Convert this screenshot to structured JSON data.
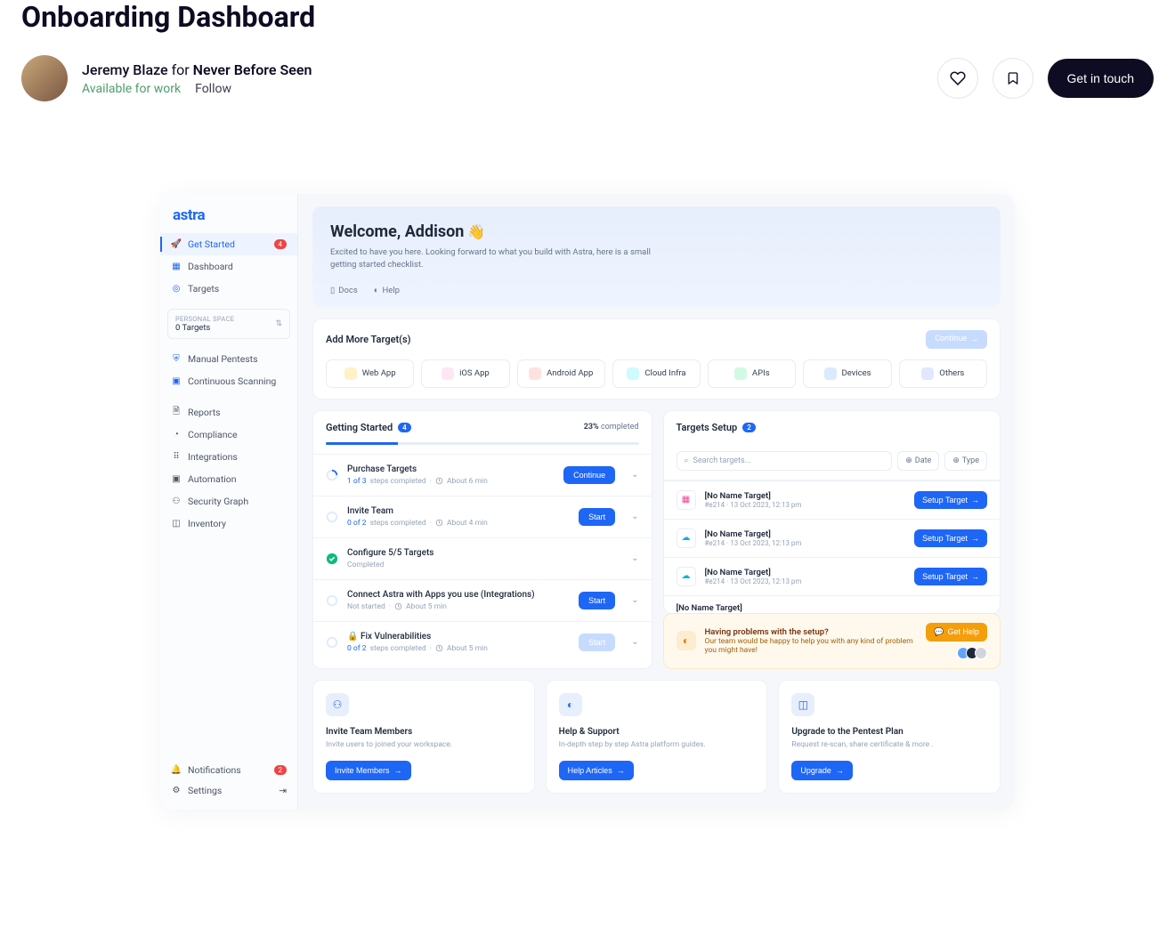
{
  "page": {
    "title": "Onboarding Dashboard",
    "author_name": "Jeremy Blaze",
    "author_for": "for",
    "author_team": "Never Before Seen",
    "available": "Available for work",
    "follow": "Follow",
    "get_in_touch": "Get in touch"
  },
  "sidebar": {
    "brand": "astra",
    "nav": [
      {
        "label": "Get Started",
        "badge": "4"
      },
      {
        "label": "Dashboard"
      },
      {
        "label": "Targets"
      }
    ],
    "space_label": "PERSONAL SPACE",
    "space_value": "0 Targets",
    "nav2": [
      {
        "label": "Manual Pentests"
      },
      {
        "label": "Continuous Scanning"
      }
    ],
    "nav3": [
      {
        "label": "Reports"
      },
      {
        "label": "Compliance"
      },
      {
        "label": "Integrations"
      },
      {
        "label": "Automation"
      },
      {
        "label": "Security Graph"
      },
      {
        "label": "Inventory"
      }
    ],
    "footer": [
      {
        "label": "Notifications",
        "badge": "2"
      },
      {
        "label": "Settings"
      }
    ]
  },
  "welcome": {
    "title": "Welcome, Addison",
    "sub": "Excited to have you here. Looking forward to what you build with Astra, here is a small getting started checklist.",
    "links": [
      "Docs",
      "Help"
    ]
  },
  "add_targets": {
    "title": "Add More Target(s)",
    "continue": "Continue",
    "chips": [
      "Web App",
      "iOS App",
      "Android App",
      "Cloud Infra",
      "APIs",
      "Devices",
      "Others"
    ]
  },
  "getting_started": {
    "title": "Getting Started",
    "count": "4",
    "pct": "23%",
    "completed_label": "completed",
    "rows": [
      {
        "title": "Purchase Targets",
        "sub_pre": "1 of 3",
        "sub_post": "steps completed",
        "time": "About 6 min",
        "btn": "Continue",
        "status": "progress"
      },
      {
        "title": "Invite Team",
        "sub_pre": "0 of 2",
        "sub_post": "steps completed",
        "time": "About 4 min",
        "btn": "Start",
        "status": "progress"
      },
      {
        "title": "Configure 5/5 Targets",
        "sub_complete": "Completed",
        "status": "done"
      },
      {
        "title": "Connect Astra with Apps you use (Integrations)",
        "sub_not": "Not started",
        "time": "About 5 min",
        "btn": "Start",
        "status": "pending"
      },
      {
        "title": "Fix Vulnerabilities",
        "sub_pre": "0 of 2",
        "sub_post": "steps completed",
        "time": "About 5 min",
        "btn": "Start",
        "status": "pending",
        "disabled": true,
        "lock": true
      }
    ]
  },
  "targets_setup": {
    "title": "Targets Setup",
    "count": "2",
    "search_ph": "Search targets...",
    "filter_date": "Date",
    "filter_type": "Type",
    "rows": [
      {
        "name": "[No Name Target]",
        "meta": "#e214   ·   13 Oct 2023, 12:13 pm",
        "btn": "Setup Target"
      },
      {
        "name": "[No Name Target]",
        "meta": "#e214   ·   13 Oct 2023, 12:13 pm",
        "btn": "Setup Target"
      },
      {
        "name": "[No Name Target]",
        "meta": "#e214   ·   13 Oct 2023, 12:13 pm",
        "btn": "Setup Target"
      }
    ],
    "partial_name": "[No Name Target]"
  },
  "help": {
    "title": "Having problems with the setup?",
    "sub": "Our team would be happy to help you with any kind of problem you might have!",
    "btn": "Get Help"
  },
  "bottom": [
    {
      "title": "Invite Team Members",
      "sub": "Invite users to joined your workspace.",
      "btn": "Invite Members"
    },
    {
      "title": "Help & Support",
      "sub": "In-depth step by step Astra platform guides.",
      "btn": "Help Articles"
    },
    {
      "title": "Upgrade to the Pentest Plan",
      "sub": "Request re-scan, share certificate & more .",
      "btn": "Upgrade"
    }
  ]
}
